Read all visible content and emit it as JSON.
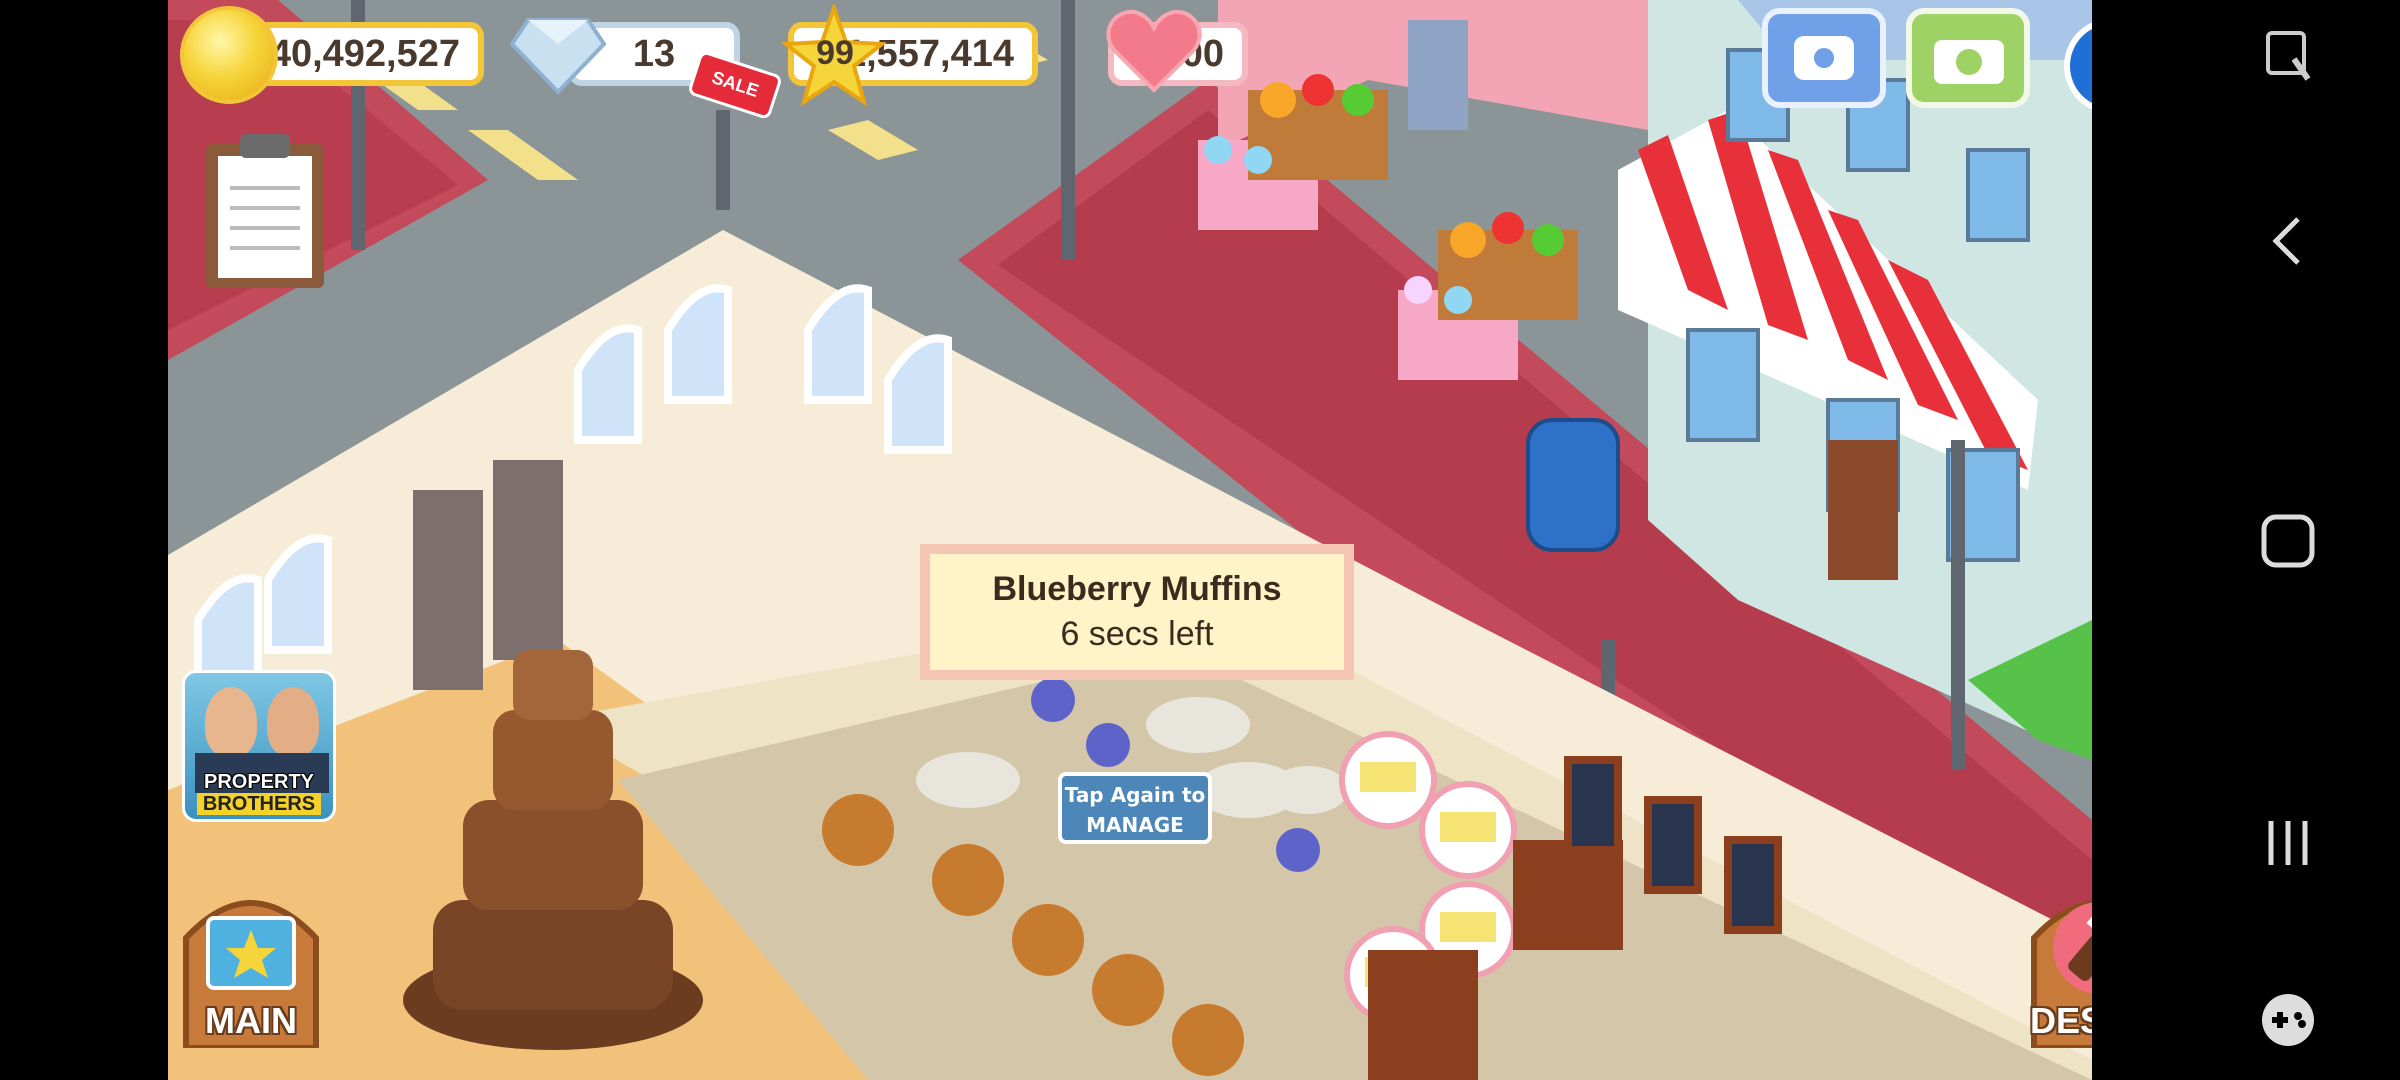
{
  "hud": {
    "coins": "40,492,527",
    "gems": "13",
    "sale_badge": "SALE",
    "level": "99",
    "xp": "1,557,414",
    "hearts": "100"
  },
  "tooltip": {
    "title": "Blueberry Muffins",
    "time_left": "6 secs left"
  },
  "manage_hint": {
    "line1": "Tap Again to",
    "line2": "MANAGE"
  },
  "promo": {
    "line1": "PROPERTY",
    "line2": "BROTHERS"
  },
  "buttons": {
    "main": "MAIN",
    "design": "DESIGN"
  },
  "colors": {
    "coin_gold": "#f6d53a",
    "heart_red": "#f06070",
    "tooltip_bg": "#fff3c8",
    "manage_blue": "#4d86b8",
    "awning_red": "#e8303a"
  },
  "icons": {
    "phone": "phone-icon",
    "camera": "camera-icon",
    "account": "account-icon",
    "clipboard": "clipboard-icon",
    "gem": "gem-icon",
    "star": "star-icon",
    "heart": "heart-icon"
  }
}
